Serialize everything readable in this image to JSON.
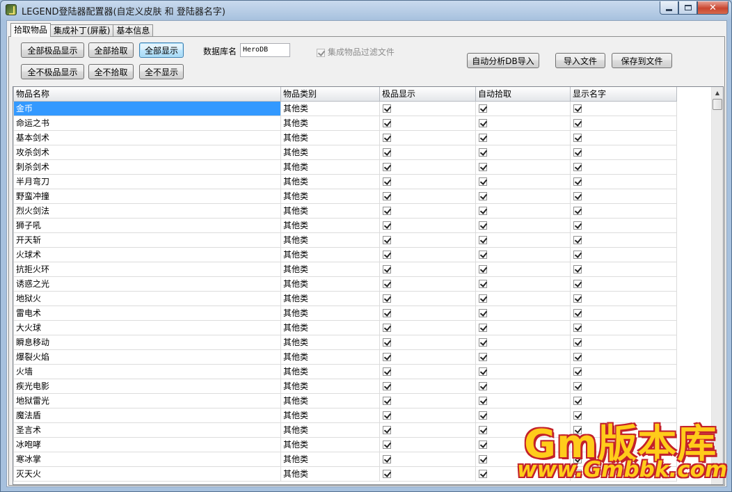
{
  "window": {
    "title": "LEGEND登陆器配置器(自定义皮肤 和 登陆器名字)",
    "min_icon": "minimize-icon",
    "max_icon": "maximize-icon",
    "close_icon": "close-icon",
    "close_glyph": "✕"
  },
  "tabs": [
    {
      "label": "拾取物品",
      "active": true
    },
    {
      "label": "集成补丁(屏蔽)",
      "active": false
    },
    {
      "label": "基本信息",
      "active": false
    }
  ],
  "toolbar": {
    "all_premium_show": "全部极品显示",
    "all_pickup": "全部拾取",
    "all_show": "全部显示",
    "none_premium_show": "全不极品显示",
    "none_pickup": "全不拾取",
    "none_show": "全不显示",
    "db_label": "数据库名",
    "db_value": "HeroDB",
    "filter_checkbox_label": "集成物品过滤文件",
    "filter_checked": true,
    "auto_import": "自动分析DB导入",
    "import_file": "导入文件",
    "save_file": "保存到文件"
  },
  "grid": {
    "columns": [
      "物品名称",
      "物品类别",
      "极品显示",
      "自动拾取",
      "显示名字"
    ],
    "rows": [
      {
        "name": "金币",
        "category": "其他类",
        "premium": true,
        "pickup": true,
        "show_name": true,
        "selected": true
      },
      {
        "name": "命运之书",
        "category": "其他类",
        "premium": true,
        "pickup": true,
        "show_name": true
      },
      {
        "name": "基本剑术",
        "category": "其他类",
        "premium": true,
        "pickup": true,
        "show_name": true
      },
      {
        "name": "攻杀剑术",
        "category": "其他类",
        "premium": true,
        "pickup": true,
        "show_name": true
      },
      {
        "name": "刺杀剑术",
        "category": "其他类",
        "premium": true,
        "pickup": true,
        "show_name": true
      },
      {
        "name": "半月弯刀",
        "category": "其他类",
        "premium": true,
        "pickup": true,
        "show_name": true
      },
      {
        "name": "野蛮冲撞",
        "category": "其他类",
        "premium": true,
        "pickup": true,
        "show_name": true
      },
      {
        "name": "烈火剑法",
        "category": "其他类",
        "premium": true,
        "pickup": true,
        "show_name": true
      },
      {
        "name": "狮子吼",
        "category": "其他类",
        "premium": true,
        "pickup": true,
        "show_name": true
      },
      {
        "name": "开天斩",
        "category": "其他类",
        "premium": true,
        "pickup": true,
        "show_name": true
      },
      {
        "name": "火球术",
        "category": "其他类",
        "premium": true,
        "pickup": true,
        "show_name": true
      },
      {
        "name": "抗拒火环",
        "category": "其他类",
        "premium": true,
        "pickup": true,
        "show_name": true
      },
      {
        "name": "诱惑之光",
        "category": "其他类",
        "premium": true,
        "pickup": true,
        "show_name": true
      },
      {
        "name": "地狱火",
        "category": "其他类",
        "premium": true,
        "pickup": true,
        "show_name": true
      },
      {
        "name": "雷电术",
        "category": "其他类",
        "premium": true,
        "pickup": true,
        "show_name": true
      },
      {
        "name": "大火球",
        "category": "其他类",
        "premium": true,
        "pickup": true,
        "show_name": true
      },
      {
        "name": "瞬息移动",
        "category": "其他类",
        "premium": true,
        "pickup": true,
        "show_name": true
      },
      {
        "name": "爆裂火焰",
        "category": "其他类",
        "premium": true,
        "pickup": true,
        "show_name": true
      },
      {
        "name": "火墙",
        "category": "其他类",
        "premium": true,
        "pickup": true,
        "show_name": true
      },
      {
        "name": "疾光电影",
        "category": "其他类",
        "premium": true,
        "pickup": true,
        "show_name": true
      },
      {
        "name": "地狱雷光",
        "category": "其他类",
        "premium": true,
        "pickup": true,
        "show_name": true
      },
      {
        "name": "魔法盾",
        "category": "其他类",
        "premium": true,
        "pickup": true,
        "show_name": true
      },
      {
        "name": "圣言术",
        "category": "其他类",
        "premium": true,
        "pickup": true,
        "show_name": true
      },
      {
        "name": "冰咆哮",
        "category": "其他类",
        "premium": true,
        "pickup": true,
        "show_name": true
      },
      {
        "name": "寒冰掌",
        "category": "其他类",
        "premium": true,
        "pickup": true,
        "show_name": true
      },
      {
        "name": "灭天火",
        "category": "其他类",
        "premium": true,
        "pickup": true,
        "show_name": true
      }
    ]
  },
  "scrollbar": {
    "up_icon": "scroll-up-arrow-icon",
    "up_glyph": "▲"
  },
  "watermark": {
    "line1": "Gm版本库",
    "line2": "www.Gmbbk.com"
  }
}
